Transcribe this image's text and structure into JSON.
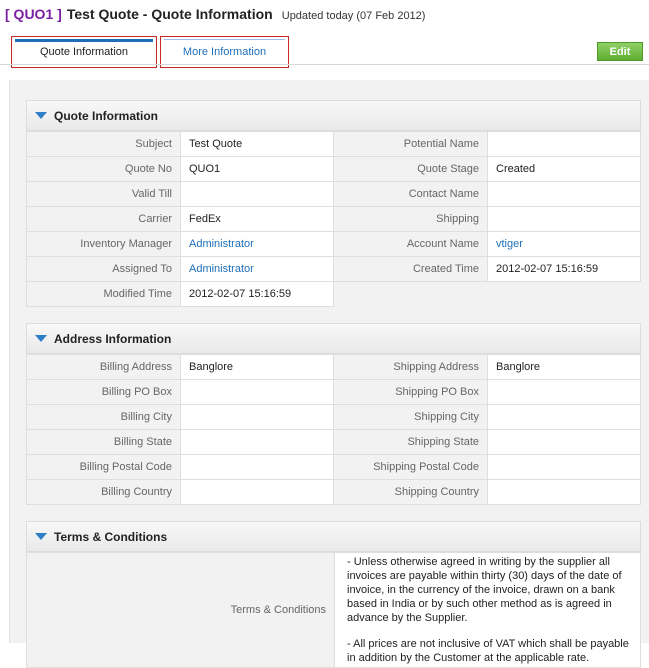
{
  "header": {
    "record_id": "[ QUO1 ]",
    "title": "Test Quote - Quote Information",
    "updated": "Updated today (07 Feb 2012)"
  },
  "tabs": [
    {
      "label": "Quote Information",
      "active": true
    },
    {
      "label": "More Information",
      "active": false
    }
  ],
  "edit_label": "Edit",
  "quote_info": {
    "title": "Quote Information",
    "rows": [
      [
        "Subject",
        "Test Quote",
        "Potential Name",
        ""
      ],
      [
        "Quote No",
        "QUO1",
        "Quote Stage",
        "Created"
      ],
      [
        "Valid Till",
        "",
        "Contact Name",
        ""
      ],
      [
        "Carrier",
        "FedEx",
        "Shipping",
        ""
      ],
      [
        "Inventory Manager",
        "Administrator",
        "Account Name",
        "vtiger"
      ],
      [
        "Assigned To",
        "Administrator",
        "Created Time",
        "2012-02-07 15:16:59"
      ],
      [
        "Modified Time",
        "2012-02-07 15:16:59",
        "",
        ""
      ]
    ]
  },
  "address_info": {
    "title": "Address Information",
    "rows": [
      [
        "Billing Address",
        "Banglore",
        "Shipping Address",
        "Banglore"
      ],
      [
        "Billing PO Box",
        "",
        "Shipping PO Box",
        ""
      ],
      [
        "Billing City",
        "",
        "Shipping City",
        ""
      ],
      [
        "Billing State",
        "",
        "Shipping State",
        ""
      ],
      [
        "Billing Postal Code",
        "",
        "Shipping Postal Code",
        ""
      ],
      [
        "Billing Country",
        "",
        "Shipping Country",
        ""
      ]
    ]
  },
  "terms": {
    "title": "Terms & Conditions",
    "label": "Terms & Conditions",
    "paragraphs": [
      " - Unless otherwise agreed in writing by the supplier all invoices are payable within thirty (30) days of the date of invoice, in the currency of the invoice, drawn on a bank based in India or by such other method as is agreed in advance by the Supplier.",
      " - All prices are not inclusive of VAT which shall be payable in addition by the Customer at the applicable rate."
    ]
  },
  "colors": {
    "record_id": "#7b1fa2",
    "link": "#1e6fb8",
    "edit_button": "#6dbb3d",
    "tab_highlight": "#c62828"
  }
}
